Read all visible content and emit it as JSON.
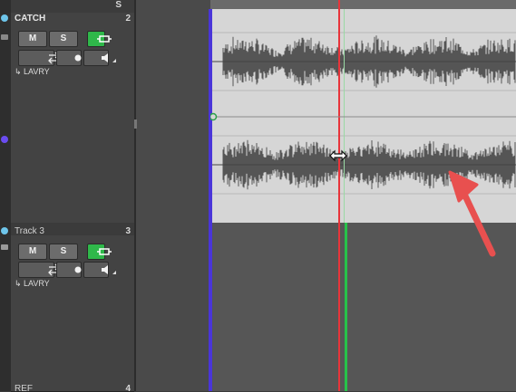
{
  "header": {
    "solo_column_label": "S"
  },
  "tracks": [
    {
      "name": "CATCH",
      "number": "2",
      "mute_label": "M",
      "solo_label": "S",
      "output": "LAVRY",
      "colors": {
        "monitor_button": "#2fb84a"
      }
    },
    {
      "name": "Track 3",
      "number": "3",
      "mute_label": "M",
      "solo_label": "S",
      "output": "LAVRY",
      "colors": {
        "monitor_button": "#2fb84a"
      }
    },
    {
      "name": "REF",
      "number": "4"
    }
  ],
  "icons": [
    "lock-icon",
    "record-arm-icon",
    "volume-icon",
    "swap-icon",
    "resize-cursor-icon",
    "annotation-arrow-icon"
  ],
  "colors": {
    "playhead": "#e8343a",
    "clip_start": "#4a35d9",
    "green_marker": "#27c24a",
    "annotation_arrow": "#e8504f"
  }
}
